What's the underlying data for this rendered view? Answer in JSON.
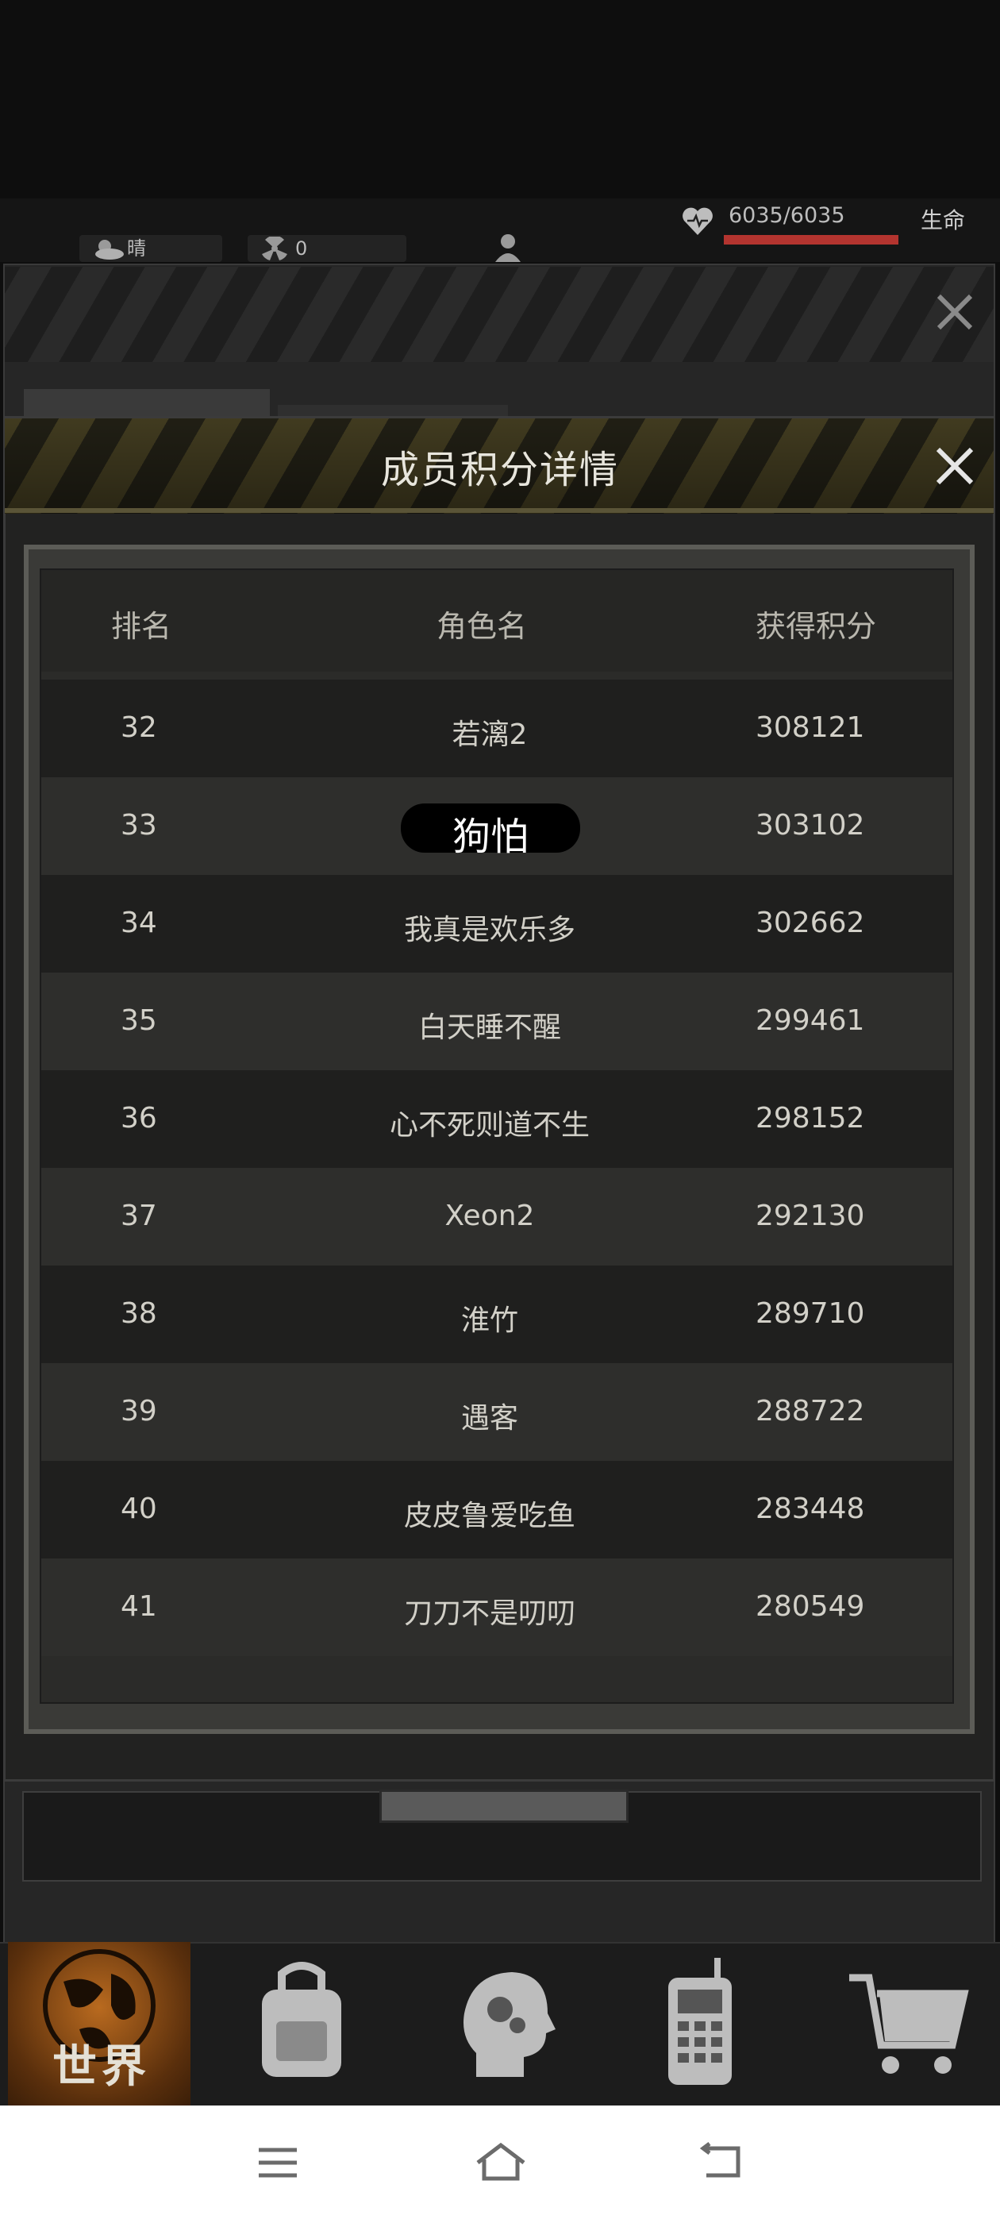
{
  "status": {
    "weather_label": "晴",
    "radiation_value": "0",
    "hp_text": "6035/6035",
    "hp_label": "生命",
    "hp_fraction": 1.0
  },
  "modal": {
    "title": "成员积分详情",
    "columns": {
      "rank": "排名",
      "name": "角色名",
      "score": "获得积分"
    },
    "rows": [
      {
        "rank": "32",
        "name": "若漓2",
        "score": "308121"
      },
      {
        "rank": "33",
        "name": "狗怕",
        "score": "303102"
      },
      {
        "rank": "34",
        "name": "我真是欢乐多",
        "score": "302662"
      },
      {
        "rank": "35",
        "name": "白天睡不醒",
        "score": "299461"
      },
      {
        "rank": "36",
        "name": "心不死则道不生",
        "score": "298152"
      },
      {
        "rank": "37",
        "name": "Xeon2",
        "score": "292130"
      },
      {
        "rank": "38",
        "name": "淮竹",
        "score": "289710"
      },
      {
        "rank": "39",
        "name": "遇客",
        "score": "288722"
      },
      {
        "rank": "40",
        "name": "皮皮鲁爱吃鱼",
        "score": "283448"
      },
      {
        "rank": "41",
        "name": "刀刀不是叨叨",
        "score": "280549"
      }
    ]
  },
  "bottom_nav": {
    "world_label": "世界",
    "items": [
      "world-icon",
      "backpack-icon",
      "skills-head-icon",
      "radio-icon",
      "shop-cart-icon"
    ]
  },
  "system_nav": [
    "menu-icon",
    "home-icon",
    "back-icon"
  ],
  "colors": {
    "accent_hp": "#b3342f",
    "header_stripe_yellow": "#4c4525",
    "world_orange": "#b96a1f"
  }
}
